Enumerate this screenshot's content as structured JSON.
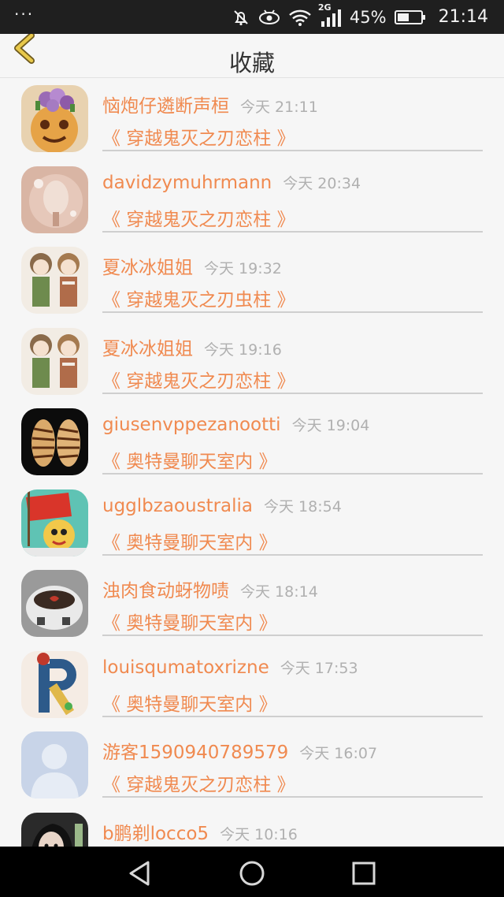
{
  "status_bar": {
    "menu_dots": "···",
    "battery": "45%",
    "time": "21:14",
    "network": "2G"
  },
  "header": {
    "title": "收藏",
    "back_icon": "chevron-left-icon"
  },
  "colors": {
    "accent": "#f08a50",
    "back_arrow": "#e8c84a",
    "time_gray": "#b0b0b0"
  },
  "favorites": [
    {
      "user": "恼炮仔遴断声桓",
      "time": "今天 21:11",
      "title": "《 穿越鬼灭之刃恋柱 》",
      "avatar": "food-avatar"
    },
    {
      "user": "davidzymuhrmann",
      "time": "今天 20:34",
      "title": "《 穿越鬼灭之刃恋柱 》",
      "avatar": "glass-avatar"
    },
    {
      "user": "夏冰冰姐姐",
      "time": "今天 19:32",
      "title": "《 穿越鬼灭之刃虫柱 》",
      "avatar": "anime-avatar"
    },
    {
      "user": "夏冰冰姐姐",
      "time": "今天 19:16",
      "title": "《 穿越鬼灭之刃恋柱 》",
      "avatar": "anime-avatar"
    },
    {
      "user": "giusenvppezanootti",
      "time": "今天 19:04",
      "title": "《 奥特曼聊天室内 》",
      "avatar": "shell-avatar"
    },
    {
      "user": "ugglbzaoustralia",
      "time": "今天 18:54",
      "title": "《 奥特曼聊天室内 》",
      "avatar": "cartoon-avatar"
    },
    {
      "user": "浊肉食动蚜物啧",
      "time": "今天 18:14",
      "title": "《 奥特曼聊天室内 》",
      "avatar": "cup-avatar"
    },
    {
      "user": "louisqumatoxrizne",
      "time": "今天 17:53",
      "title": "《 奥特曼聊天室内 》",
      "avatar": "letter-r-avatar"
    },
    {
      "user": "游客1590940789579",
      "time": "今天 16:07",
      "title": "《 穿越鬼灭之刃恋柱 》",
      "avatar": "default-avatar"
    },
    {
      "user": "b鹏剃locco5",
      "time": "今天 10:16",
      "title": "",
      "avatar": "girl-avatar"
    }
  ]
}
